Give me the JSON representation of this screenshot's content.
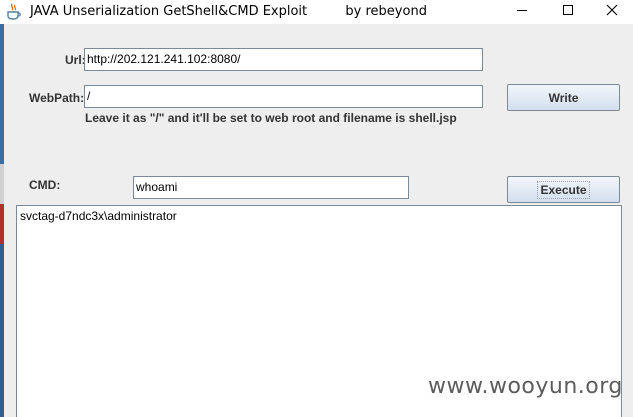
{
  "window": {
    "title": "JAVA Unserialization GetShell&CMD Exploit",
    "author": "by rebeyond",
    "icon": "java-cup-icon",
    "controls": [
      "minimize-icon",
      "maximize-icon",
      "close-icon"
    ]
  },
  "form": {
    "url_label": "Url:",
    "url_value": "http://202.121.241.102:8080/",
    "webpath_label": "WebPath:",
    "webpath_value": "/",
    "hint": "Leave it as \"/\" and it'll be set to web root and filename is shell.jsp",
    "write_button": "Write",
    "cmd_label": "CMD:",
    "cmd_value": "whoami",
    "execute_button": "Execute"
  },
  "output": {
    "text": "svctag-d7ndc3x\\administrator"
  },
  "watermark": "www.wooyun.org"
}
